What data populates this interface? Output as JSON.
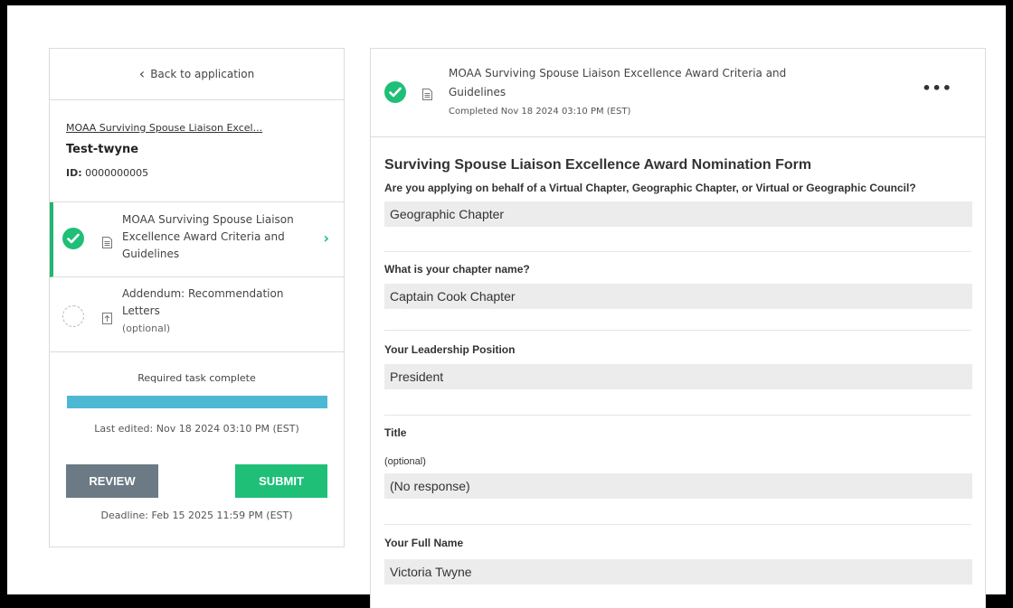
{
  "sidebar": {
    "back_label": "Back to application",
    "application_name": "MOAA Surviving Spouse Liaison Excel...",
    "applicant": "Test-twyne",
    "id_label": "ID:",
    "id_value": "0000000005",
    "tasks": [
      {
        "title": "MOAA Surviving Spouse Liaison Excellence Award Criteria and Guidelines",
        "status": "complete",
        "icon": "document-icon"
      },
      {
        "title": "Addendum: Recommendation Letters",
        "optional_label": "(optional)",
        "status": "not-started",
        "icon": "upload-icon"
      }
    ],
    "progress_label": "Required task complete",
    "progress_fraction": 1.0,
    "last_edited": "Last edited: Nov 18 2024 03:10 PM (EST)",
    "review_label": "REVIEW",
    "submit_label": "SUBMIT",
    "deadline": "Deadline: Feb 15 2025 11:59 PM (EST)"
  },
  "main": {
    "task_title": "MOAA Surviving Spouse Liaison Excellence Award Criteria and Guidelines",
    "completed": "Completed Nov 18 2024 03:10 PM (EST)",
    "more_label": "•••",
    "form_title": "Surviving Spouse Liaison Excellence Award Nomination Form",
    "questions": [
      {
        "label": "Are you applying on behalf of a Virtual Chapter, Geographic Chapter, or Virtual or Geographic Council?",
        "answer": "Geographic Chapter"
      },
      {
        "label": "What is your chapter name?",
        "answer": "Captain Cook Chapter"
      },
      {
        "label": "Your Leadership Position",
        "answer": "President"
      },
      {
        "label": "Title",
        "optional": "(optional)",
        "answer": "(No response)"
      },
      {
        "label": "Your Full Name",
        "answer": "Victoria Twyne"
      }
    ]
  },
  "colors": {
    "success": "#1fbf78",
    "progress": "#4db8d3",
    "review_button": "#6b7a84"
  }
}
